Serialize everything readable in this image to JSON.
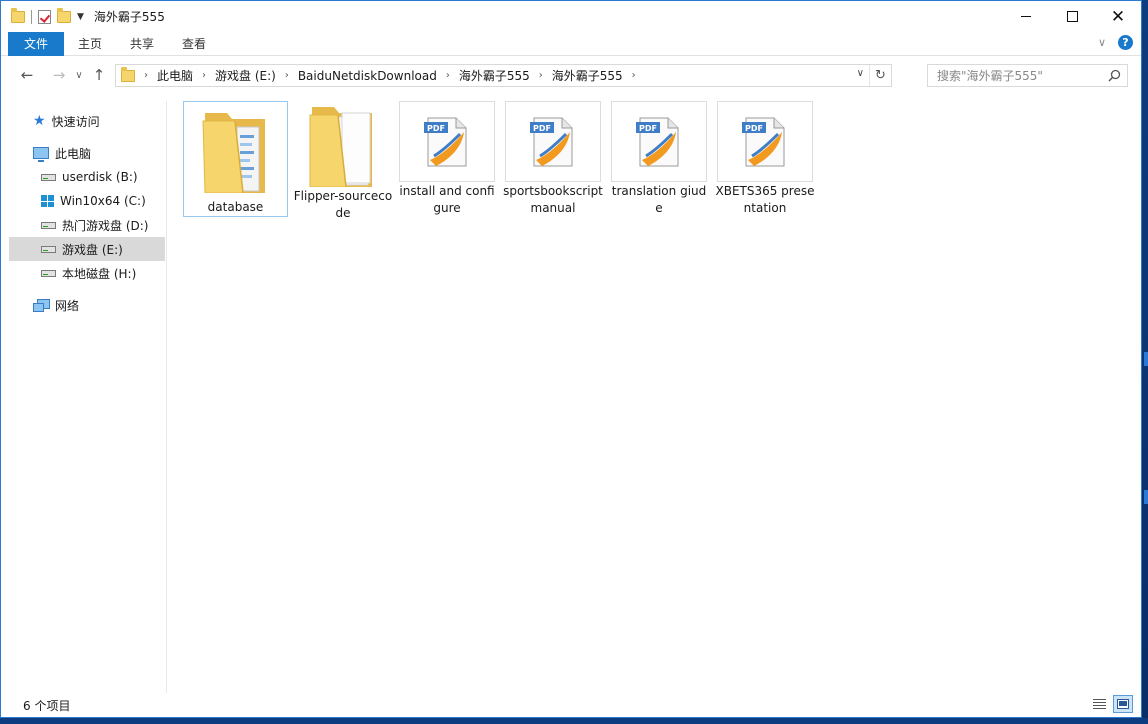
{
  "window": {
    "title": "海外霸子555",
    "close_glyph": "✕"
  },
  "ribbon": {
    "tabs": [
      {
        "label": "文件",
        "active": true
      },
      {
        "label": "主页"
      },
      {
        "label": "共享"
      },
      {
        "label": "查看"
      }
    ],
    "help_glyph": "?"
  },
  "address": {
    "crumbs": [
      "此电脑",
      "游戏盘 (E:)",
      "BaiduNetdiskDownload",
      "海外霸子555",
      "海外霸子555"
    ],
    "refresh_glyph": "↻"
  },
  "search": {
    "placeholder": "搜索\"海外霸子555\""
  },
  "sidebar": {
    "items": [
      {
        "label": "快速访问",
        "icon": "star-icon"
      },
      {
        "label": "此电脑",
        "icon": "pc-icon"
      },
      {
        "label": "userdisk (B:)",
        "icon": "drive-icon"
      },
      {
        "label": "Win10x64 (C:)",
        "icon": "windows-drive-icon"
      },
      {
        "label": "热门游戏盘 (D:)",
        "icon": "drive-icon"
      },
      {
        "label": "游戏盘 (E:)",
        "icon": "drive-icon",
        "selected": true
      },
      {
        "label": "本地磁盘 (H:)",
        "icon": "drive-icon"
      },
      {
        "label": "网络",
        "icon": "network-icon"
      }
    ]
  },
  "files": [
    {
      "name": "database",
      "type": "folder",
      "selected": true
    },
    {
      "name": "Flipper-sourcecode",
      "type": "folder"
    },
    {
      "name": "install and configure",
      "type": "pdf"
    },
    {
      "name": "sportsbookscript manual",
      "type": "pdf"
    },
    {
      "name": "translation giude",
      "type": "pdf"
    },
    {
      "name": "XBETS365 presentation",
      "type": "pdf"
    }
  ],
  "status": {
    "item_count": "6 个项目"
  },
  "colors": {
    "accent": "#1979ca",
    "selection": "#cce8ff",
    "folder": "#f6d66c"
  }
}
